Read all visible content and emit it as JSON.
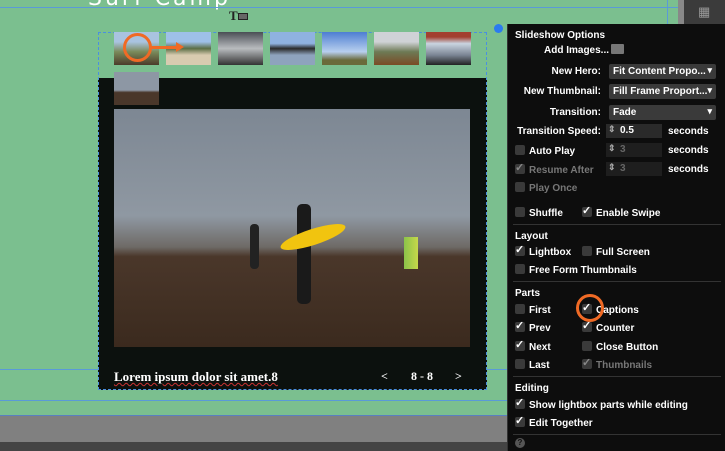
{
  "page": {
    "title": "Surf Camp"
  },
  "lightbox": {
    "caption": "Lorem ipsum dolor sit amet.8",
    "prev": "<",
    "next": ">",
    "counter": "8 - 8"
  },
  "thumbnails": [
    {
      "icon": "rocks-coast"
    },
    {
      "icon": "lifeguard-tower"
    },
    {
      "icon": "misty-sea"
    },
    {
      "icon": "rock-arch"
    },
    {
      "icon": "cloudy-sky"
    },
    {
      "icon": "foggy-hills"
    },
    {
      "icon": "golden-gate-bridge"
    },
    {
      "icon": "surfers"
    }
  ],
  "panel": {
    "title": "Slideshow Options",
    "add_images": "Add Images...",
    "new_hero_label": "New Hero:",
    "new_hero": "Fit Content Propo...",
    "new_thumb_label": "New Thumbnail:",
    "new_thumb": "Fill Frame Proport...",
    "transition_label": "Transition:",
    "transition": "Fade",
    "speed_label": "Transition Speed:",
    "speed": "0.5",
    "seconds": "seconds",
    "auto_play": "Auto Play",
    "auto_play_value": "3",
    "resume_after": "Resume After",
    "resume_value": "3",
    "play_once": "Play Once",
    "shuffle": "Shuffle",
    "enable_swipe": "Enable Swipe",
    "layout": "Layout",
    "lightbox": "Lightbox",
    "full_screen": "Full Screen",
    "free_form": "Free Form Thumbnails",
    "parts": "Parts",
    "first": "First",
    "captions": "Captions",
    "prev": "Prev",
    "counter": "Counter",
    "next": "Next",
    "close_button": "Close Button",
    "last": "Last",
    "thumbnails": "Thumbnails",
    "editing": "Editing",
    "show_parts": "Show lightbox parts while editing",
    "edit_together": "Edit Together",
    "help": "?"
  },
  "colors": {
    "background": "#7bbf8f",
    "panel": "#0d0d0d",
    "highlight": "#f06a25"
  }
}
